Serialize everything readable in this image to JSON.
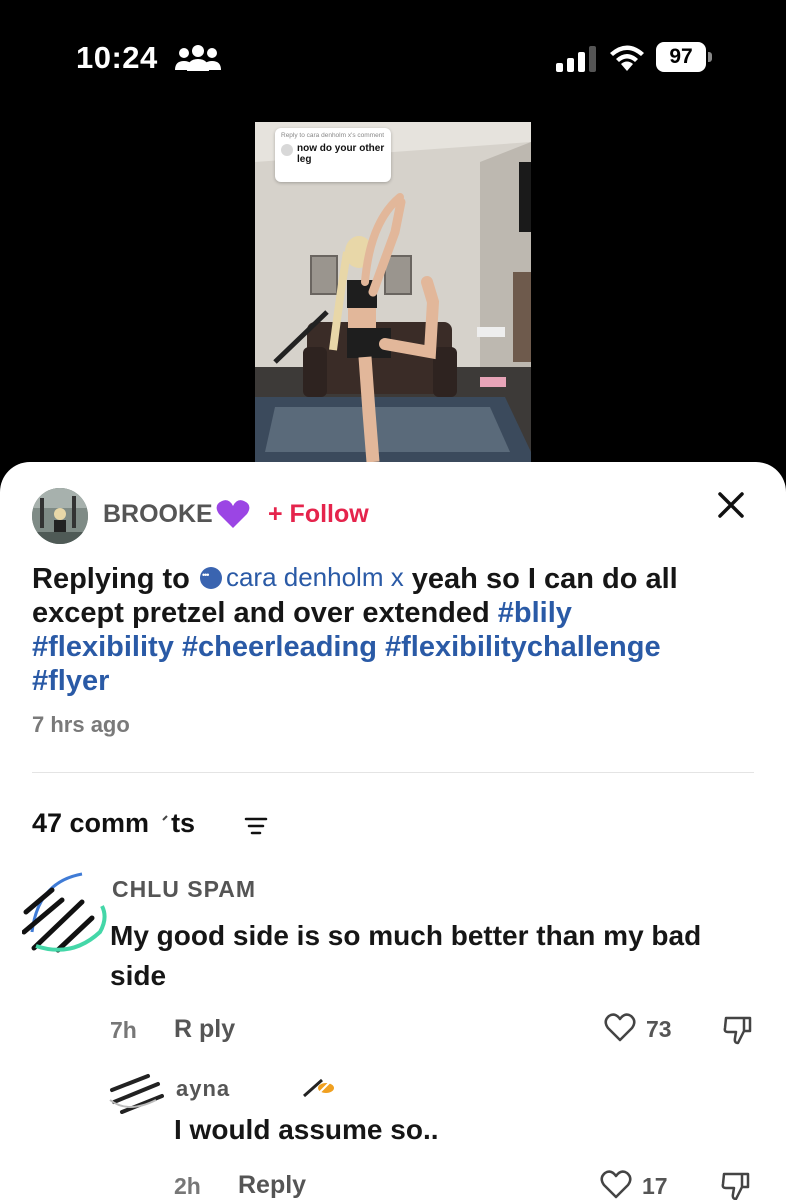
{
  "status_bar": {
    "time": "10:24",
    "battery": "97",
    "icons": [
      "people-icon",
      "signal-icon",
      "wifi-icon",
      "battery-icon"
    ]
  },
  "video": {
    "reply_sticker": {
      "header": "Reply to cara denholm x's comment",
      "text": "now do your other leg"
    }
  },
  "post": {
    "username": "BROOKE",
    "username_emoji": "purple-heart-icon",
    "follow_label": "+ Follow",
    "replying_prefix": "Replying to ",
    "mention": "cara denholm x",
    "caption_text": " yeah so I can do all except pretzel and over extended ",
    "hashtags": [
      "#blily",
      "#flexibility",
      "#cheerleading",
      "#flexibilitychallenge",
      "#flyer"
    ],
    "time": "7 hrs ago"
  },
  "comments_header": {
    "count_label": "47 comm",
    "count_label_end": "ts"
  },
  "comments": [
    {
      "name": "CHLU  SPAM",
      "text": "My good side is so much better than my bad side",
      "time": "7h",
      "reply_label": "R ply",
      "likes": "73"
    },
    {
      "name": "ayna",
      "text": "I would assume so..",
      "time": "2h",
      "reply_label": "Reply",
      "likes": "17"
    }
  ],
  "colors": {
    "follow": "#e5244c",
    "link": "#2a5aa6",
    "text": "#161616",
    "muted": "#777777"
  }
}
